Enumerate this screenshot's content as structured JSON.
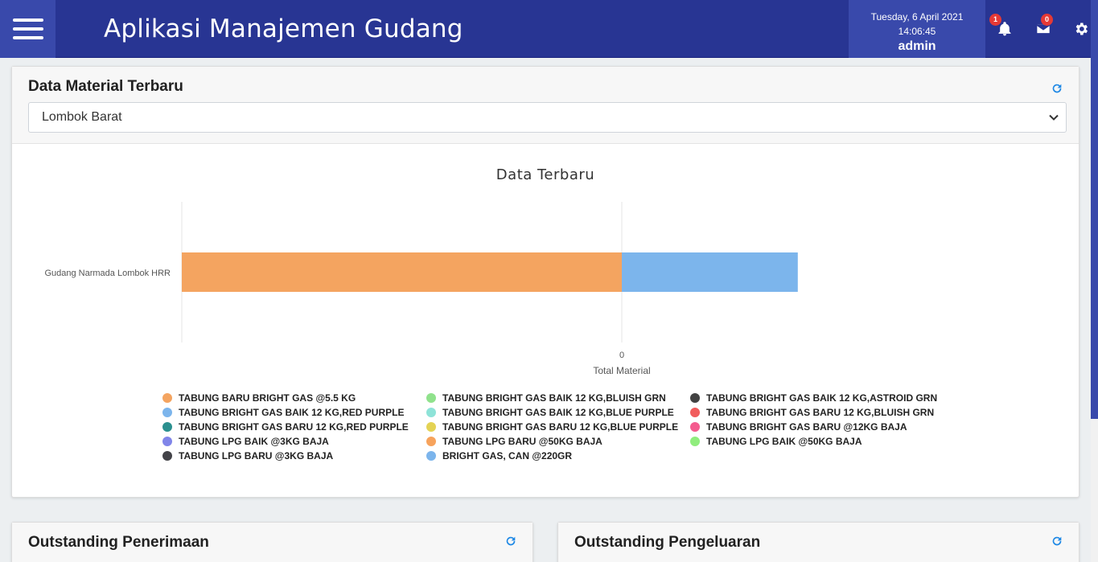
{
  "header": {
    "app_title": "Aplikasi Manajemen Gudang",
    "date": "Tuesday, 6 April 2021",
    "time": "14:06:45",
    "user": "admin",
    "notification_count": "1",
    "message_count": "0"
  },
  "material_card": {
    "title": "Data Material Terbaru",
    "selected_region": "Lombok Barat"
  },
  "chart_data": {
    "type": "bar",
    "orientation": "horizontal",
    "stacked": true,
    "title": "Data Terbaru",
    "categories": [
      "Gudang Narmada Lombok HRR"
    ],
    "xlabel": "Total Material",
    "ylabel": "",
    "x_ticks": [
      "0"
    ],
    "xlim": [
      -1,
      1
    ],
    "series": [
      {
        "name": "TABUNG BARU BRIGHT GAS @5.5 KG",
        "color": "#f4a460",
        "values": [
          0
        ]
      },
      {
        "name": "TABUNG BRIGHT GAS BAIK 12 KG,BLUISH GRN",
        "color": "#90e28c",
        "values": [
          0
        ]
      },
      {
        "name": "TABUNG BRIGHT GAS BAIK 12 KG,ASTROID GRN",
        "color": "#424242",
        "values": [
          0
        ]
      },
      {
        "name": "TABUNG BRIGHT GAS BAIK 12 KG,RED PURPLE",
        "color": "#7cb5ec",
        "values": [
          0
        ]
      },
      {
        "name": "TABUNG BRIGHT GAS BAIK 12 KG,BLUE PURPLE",
        "color": "#8ee3d8",
        "values": [
          0
        ]
      },
      {
        "name": "TABUNG BRIGHT GAS BARU 12 KG,BLUISH GRN",
        "color": "#f15c5c",
        "values": [
          0
        ]
      },
      {
        "name": "TABUNG BRIGHT GAS BARU 12 KG,RED PURPLE",
        "color": "#2b908f",
        "values": [
          0
        ]
      },
      {
        "name": "TABUNG BRIGHT GAS BARU 12 KG,BLUE PURPLE",
        "color": "#e4d354",
        "values": [
          0
        ]
      },
      {
        "name": "TABUNG BRIGHT GAS BARU @12KG BAJA",
        "color": "#f45b8e",
        "values": [
          0
        ]
      },
      {
        "name": "TABUNG LPG  BAIK @3KG BAJA",
        "color": "#8085e9",
        "values": [
          0
        ]
      },
      {
        "name": "TABUNG LPG  BARU @50KG BAJA",
        "color": "#f7a35c",
        "values": [
          0
        ]
      },
      {
        "name": "TABUNG LPG  BAIK @50KG BAJA",
        "color": "#90ed7d",
        "values": [
          0
        ]
      },
      {
        "name": "TABUNG LPG  BARU @3KG BAJA",
        "color": "#434348",
        "values": [
          0
        ]
      },
      {
        "name": "BRIGHT GAS, CAN @220GR",
        "color": "#7cb5ec",
        "values": [
          0.4
        ]
      }
    ],
    "negative_series": {
      "name": "TABUNG BARU BRIGHT GAS @5.5 KG",
      "values": [
        -1
      ]
    },
    "legend_position": "bottom",
    "grid": true
  },
  "outstanding_in": {
    "title": "Outstanding Penerimaan"
  },
  "outstanding_out": {
    "title": "Outstanding Pengeluaran"
  }
}
